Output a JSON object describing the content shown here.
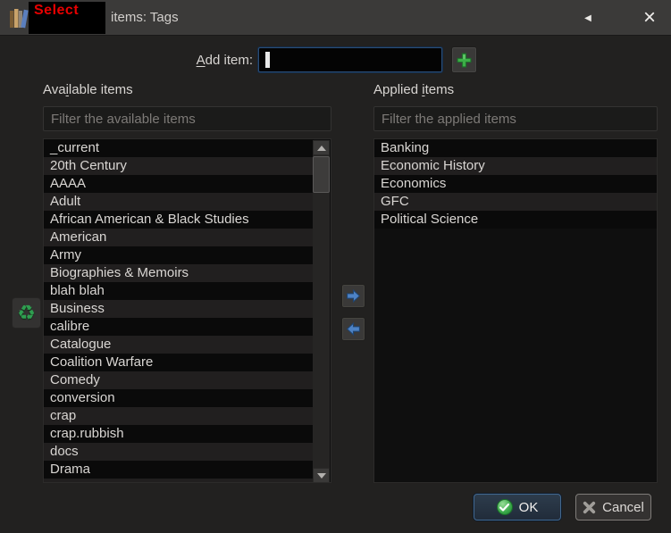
{
  "title_bar": {
    "annotation_label": "Select",
    "title": "items: Tags",
    "collapse_icon": "◀",
    "close_icon": "×"
  },
  "add_item": {
    "label_mnemonic": "A",
    "label_rest": "dd item:",
    "value": ""
  },
  "available_panel": {
    "label_pre": "Ava",
    "label_mnemonic": "i",
    "label_rest": "lable items",
    "filter_placeholder": "Filter the available items",
    "items": [
      "_current",
      "20th Century",
      "AAAA",
      "Adult",
      "African American & Black Studies",
      "American",
      "Army",
      "Biographies & Memoirs",
      "blah blah",
      "Business",
      "calibre",
      "Catalogue",
      "Coalition Warfare",
      "Comedy",
      "conversion",
      "crap",
      "crap.rubbish",
      "docs",
      "Drama"
    ]
  },
  "applied_panel": {
    "label_pre": "Applied ",
    "label_mnemonic": "i",
    "label_rest": "tems",
    "filter_placeholder": "Filter the applied items",
    "items": [
      "Banking",
      "Economic History",
      "Economics",
      "GFC",
      "Political Science"
    ]
  },
  "icons": {
    "recycle": "♻"
  },
  "footer": {
    "ok_label": "OK",
    "cancel_label": "Cancel"
  },
  "colors": {
    "annotation_red": "#e80000",
    "focus_blue": "#2a4d77",
    "add_green": "#3cae47",
    "arrow_blue": "#4d82c4",
    "ok_check_green": "#3aa94a"
  }
}
